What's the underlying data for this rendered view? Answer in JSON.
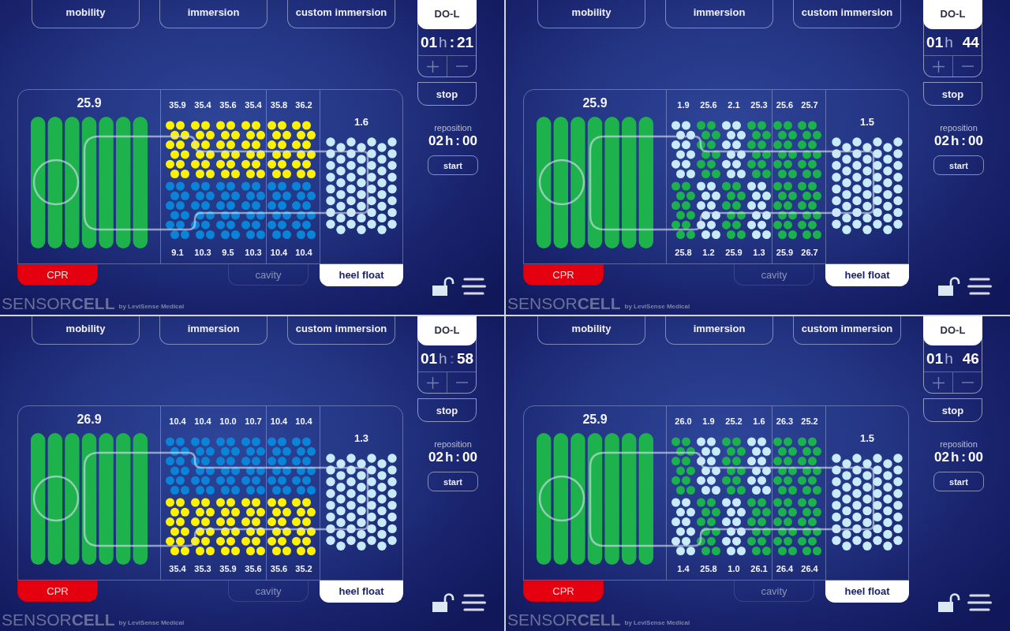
{
  "panels": [
    {
      "mode_buttons": [
        {
          "label": "mobility"
        },
        {
          "label": "immersion"
        },
        {
          "label": "custom immersion"
        }
      ],
      "profile_tab": "DO-L",
      "timer": {
        "hours": "01",
        "unit": "h",
        "separator": ":",
        "separator_faded": false,
        "minutes": "21"
      },
      "stop_button": "stop",
      "reposition": {
        "label": "reposition",
        "hours": "02",
        "unit": "h",
        "separator": ":",
        "minutes": "00",
        "start_button": "start"
      },
      "mattress": {
        "head_reading": "25.9",
        "top_zones": [
          {
            "reading": "35.9",
            "color": "#fff200"
          },
          {
            "reading": "35.4",
            "color": "#fff200"
          },
          {
            "reading": "35.6",
            "color": "#fff200"
          },
          {
            "reading": "35.4",
            "color": "#fff200"
          },
          {
            "reading": "35.8",
            "color": "#fff200"
          },
          {
            "reading": "36.2",
            "color": "#fff200"
          }
        ],
        "bottom_zones": [
          {
            "reading": "9.1",
            "color": "#0a84d8"
          },
          {
            "reading": "10.3",
            "color": "#0a84d8"
          },
          {
            "reading": "9.5",
            "color": "#0a84d8"
          },
          {
            "reading": "10.3",
            "color": "#0a84d8"
          },
          {
            "reading": "10.4",
            "color": "#0a84d8"
          },
          {
            "reading": "10.4",
            "color": "#0a84d8"
          }
        ],
        "heel_reading": "1.6"
      },
      "bottom_buttons": [
        {
          "label": "CPR",
          "kind": "emergency",
          "on": false,
          "disabled": false
        },
        {
          "label": "cavity",
          "kind": "toggle",
          "on": false,
          "disabled": true
        },
        {
          "label": "heel float",
          "kind": "toggle",
          "on": true,
          "disabled": false
        }
      ],
      "logo": {
        "wordmark": "SENSOR**CELL**",
        "tagline": "by LeviSense Medical"
      }
    },
    {
      "mode_buttons": [
        {
          "label": "mobility"
        },
        {
          "label": "immersion"
        },
        {
          "label": "custom immersion"
        }
      ],
      "profile_tab": "DO-L",
      "timer": {
        "hours": "01",
        "unit": "h",
        "minutes": "44"
      },
      "stop_button": "stop",
      "reposition": {
        "label": "reposition",
        "hours": "02",
        "unit": "h",
        "separator": ":",
        "minutes": "00",
        "start_button": "start"
      },
      "mattress": {
        "head_reading": "25.9",
        "top_zones": [
          {
            "reading": "1.9",
            "color": "#c7ebfb"
          },
          {
            "reading": "25.6",
            "color": "#1bb14c"
          },
          {
            "reading": "2.1",
            "color": "#c7ebfb"
          },
          {
            "reading": "25.3",
            "color": "#1bb14c"
          },
          {
            "reading": "25.6",
            "color": "#1bb14c"
          },
          {
            "reading": "25.7",
            "color": "#1bb14c"
          }
        ],
        "bottom_zones": [
          {
            "reading": "25.8",
            "color": "#1bb14c"
          },
          {
            "reading": "1.2",
            "color": "#c7ebfb"
          },
          {
            "reading": "25.9",
            "color": "#1bb14c"
          },
          {
            "reading": "1.3",
            "color": "#c7ebfb"
          },
          {
            "reading": "25.9",
            "color": "#1bb14c"
          },
          {
            "reading": "26.7",
            "color": "#1bb14c"
          }
        ],
        "heel_reading": "1.5"
      },
      "bottom_buttons": [
        {
          "label": "CPR",
          "kind": "emergency",
          "on": false,
          "disabled": false
        },
        {
          "label": "cavity",
          "kind": "toggle",
          "on": false,
          "disabled": true
        },
        {
          "label": "heel float",
          "kind": "toggle",
          "on": true,
          "disabled": false
        }
      ],
      "logo": {
        "wordmark": "SENSOR**CELL**",
        "tagline": "by LeviSense Medical"
      }
    },
    {
      "mode_buttons": [
        {
          "label": "mobility"
        },
        {
          "label": "immersion"
        },
        {
          "label": "custom immersion"
        }
      ],
      "profile_tab": "DO-L",
      "timer": {
        "hours": "01",
        "unit": "h",
        "separator": ":",
        "separator_faded": true,
        "minutes": "58"
      },
      "stop_button": "stop",
      "reposition": {
        "label": "reposition",
        "hours": "02",
        "unit": "h",
        "separator": ":",
        "minutes": "00",
        "start_button": "start"
      },
      "mattress": {
        "head_reading": "26.9",
        "top_zones": [
          {
            "reading": "10.4",
            "color": "#0a84d8"
          },
          {
            "reading": "10.4",
            "color": "#0a84d8"
          },
          {
            "reading": "10.0",
            "color": "#0a84d8"
          },
          {
            "reading": "10.7",
            "color": "#0a84d8"
          },
          {
            "reading": "10.4",
            "color": "#0a84d8"
          },
          {
            "reading": "10.4",
            "color": "#0a84d8"
          }
        ],
        "bottom_zones": [
          {
            "reading": "35.4",
            "color": "#fff200"
          },
          {
            "reading": "35.3",
            "color": "#fff200"
          },
          {
            "reading": "35.9",
            "color": "#fff200"
          },
          {
            "reading": "35.6",
            "color": "#fff200"
          },
          {
            "reading": "35.6",
            "color": "#fff200"
          },
          {
            "reading": "35.2",
            "color": "#fff200"
          }
        ],
        "heel_reading": "1.3"
      },
      "bottom_buttons": [
        {
          "label": "CPR",
          "kind": "emergency",
          "on": false,
          "disabled": false
        },
        {
          "label": "cavity",
          "kind": "toggle",
          "on": false,
          "disabled": true
        },
        {
          "label": "heel float",
          "kind": "toggle",
          "on": true,
          "disabled": false
        }
      ],
      "logo": {
        "wordmark": "SENSOR**CELL**",
        "tagline": "by LeviSense Medical"
      }
    },
    {
      "mode_buttons": [
        {
          "label": "mobility"
        },
        {
          "label": "immersion"
        },
        {
          "label": "custom immersion"
        }
      ],
      "profile_tab": "DO-L",
      "timer": {
        "hours": "01",
        "unit": "h",
        "minutes": "46"
      },
      "stop_button": "stop",
      "reposition": {
        "label": "reposition",
        "hours": "02",
        "unit": "h",
        "separator": ":",
        "minutes": "00",
        "start_button": "start"
      },
      "mattress": {
        "head_reading": "25.9",
        "top_zones": [
          {
            "reading": "26.0",
            "color": "#1bb14c"
          },
          {
            "reading": "1.9",
            "color": "#c7ebfb"
          },
          {
            "reading": "25.2",
            "color": "#1bb14c"
          },
          {
            "reading": "1.6",
            "color": "#c7ebfb"
          },
          {
            "reading": "26.3",
            "color": "#1bb14c"
          },
          {
            "reading": "25.2",
            "color": "#1bb14c"
          }
        ],
        "bottom_zones": [
          {
            "reading": "1.4",
            "color": "#c7ebfb"
          },
          {
            "reading": "25.8",
            "color": "#1bb14c"
          },
          {
            "reading": "1.0",
            "color": "#c7ebfb"
          },
          {
            "reading": "26.1",
            "color": "#1bb14c"
          },
          {
            "reading": "26.4",
            "color": "#1bb14c"
          },
          {
            "reading": "26.4",
            "color": "#1bb14c"
          }
        ],
        "heel_reading": "1.5"
      },
      "bottom_buttons": [
        {
          "label": "CPR",
          "kind": "emergency",
          "on": false,
          "disabled": false
        },
        {
          "label": "cavity",
          "kind": "toggle",
          "on": false,
          "disabled": true
        },
        {
          "label": "heel float",
          "kind": "toggle",
          "on": true,
          "disabled": false
        }
      ],
      "logo": {
        "wordmark": "SENSOR**CELL**",
        "tagline": "by LeviSense Medical"
      }
    }
  ]
}
